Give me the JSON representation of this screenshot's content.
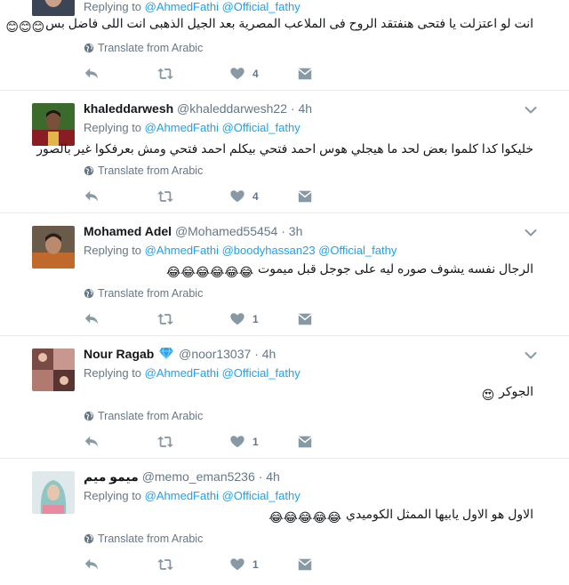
{
  "ui": {
    "replying_to_label": "Replying to",
    "translate_label": "Translate from Arabic",
    "time_separator": "·"
  },
  "colors": {
    "mention": "#1da1f2",
    "muted": "#657786",
    "divider": "#e6ecf0",
    "verified": "#2aa3ef"
  },
  "tweets": [
    {
      "mentions": [
        "@AhmedFathi",
        "@Official_fathy"
      ],
      "text": "انت لو اعتزلت يا فتحى هنفتقد الروح فى الملاعب المصرية بعد الجيل الذهبى انت اللى فاضل بس",
      "emojis": "😊😊😊",
      "likes": "4"
    },
    {
      "name": "khaleddarwesh",
      "handle": "@khaleddarwesh22",
      "time": "4h",
      "mentions": [
        "@AhmedFathi",
        "@Official_fathy"
      ],
      "text": "خليكوا كدا كلموا بعض لحد ما هيجلي هوس احمد فتحي بيكلم احمد فتحي ومش بعرفكوا غير بالصور",
      "emojis": "",
      "likes": "4"
    },
    {
      "name": "Mohamed Adel",
      "handle": "@Mohamed55454",
      "time": "3h",
      "mentions": [
        "@AhmedFathi",
        "@boodyhassan23",
        "@Official_fathy"
      ],
      "text": "الرجال نفسه يشوف صوره ليه على جوجل قبل ميموت",
      "emojis": "😂😂😂😂😂😂",
      "likes": "1"
    },
    {
      "name": "Nour Ragab",
      "verified_icon": "gem-icon",
      "handle": "@noor13037",
      "time": "4h",
      "mentions": [
        "@AhmedFathi",
        "@Official_fathy"
      ],
      "text": "الجوكر",
      "emojis": "😍",
      "likes": "1"
    },
    {
      "name": "ميمو ميم",
      "handle": "@memo_eman5236",
      "time": "4h",
      "mentions": [
        "@AhmedFathi",
        "@Official_fathy"
      ],
      "text": "الاول هو الاول يابيها الممثل الكوميدي",
      "emojis": "😂😂😂😂😂",
      "likes": "1"
    }
  ]
}
